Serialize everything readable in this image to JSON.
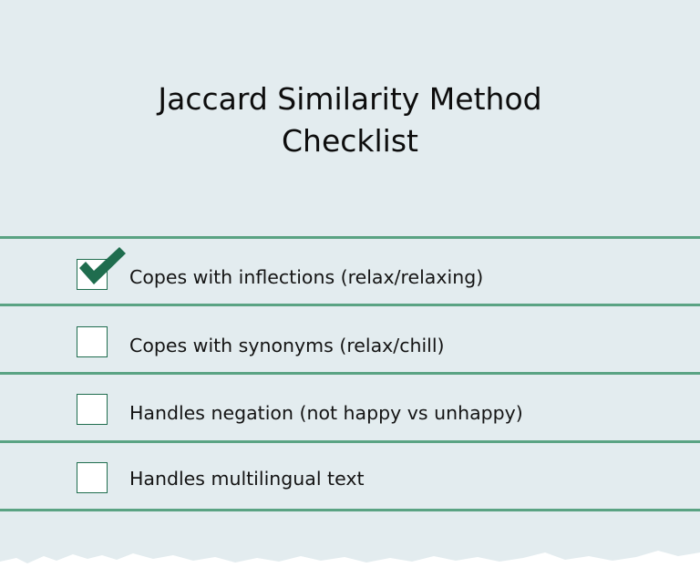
{
  "title": {
    "line1": "Jaccard Similarity Method",
    "line2": "Checklist"
  },
  "checklist": {
    "items": [
      {
        "label": "Copes with inflections (relax/relaxing)",
        "checked": true
      },
      {
        "label": "Copes with synonyms (relax/chill)",
        "checked": false
      },
      {
        "label": "Handles negation (not happy vs unhappy)",
        "checked": false
      },
      {
        "label": "Handles multilingual text",
        "checked": false
      }
    ]
  },
  "colors": {
    "background": "#e3ecef",
    "rule": "#5aa383",
    "check": "#1f6d4e",
    "box_border": "#1f6d4e"
  },
  "icons": {
    "checked": "check-mark-icon"
  }
}
